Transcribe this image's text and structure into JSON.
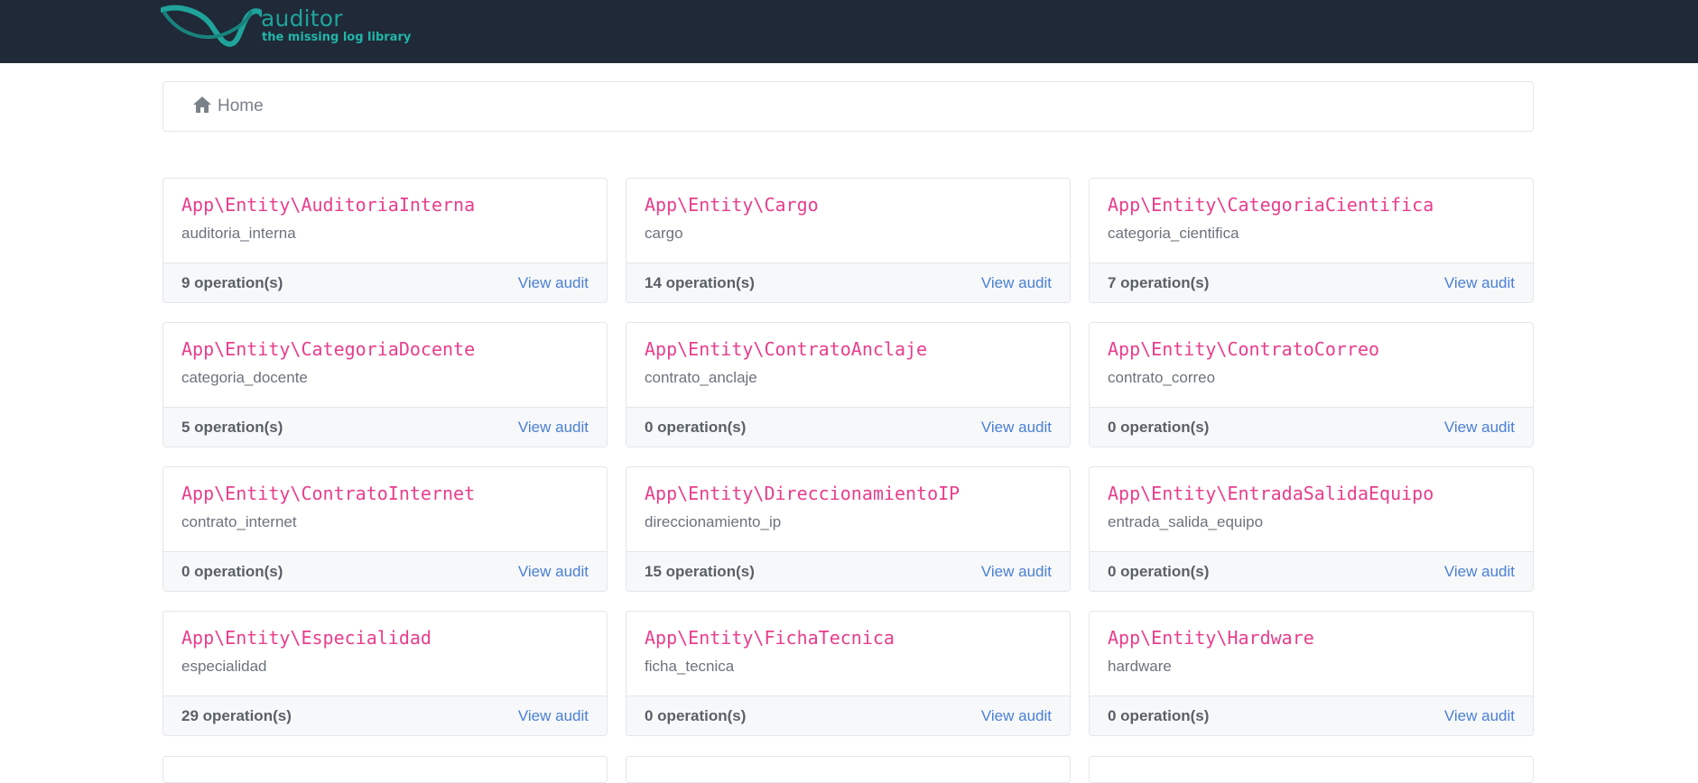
{
  "brand": {
    "name": "auditor",
    "tagline": "the missing log library",
    "name_color": "#1fa39b",
    "tagline_color": "#22b5a8"
  },
  "navbar": {
    "background": "#1f2937"
  },
  "breadcrumb": {
    "icon": "home-icon",
    "label": "Home"
  },
  "cards": [
    {
      "entity": "App\\Entity\\AuditoriaInterna",
      "table": "auditoria_interna",
      "operations": "9 operation(s)",
      "link": "View audit"
    },
    {
      "entity": "App\\Entity\\Cargo",
      "table": "cargo",
      "operations": "14 operation(s)",
      "link": "View audit"
    },
    {
      "entity": "App\\Entity\\CategoriaCientifica",
      "table": "categoria_cientifica",
      "operations": "7 operation(s)",
      "link": "View audit"
    },
    {
      "entity": "App\\Entity\\CategoriaDocente",
      "table": "categoria_docente",
      "operations": "5 operation(s)",
      "link": "View audit"
    },
    {
      "entity": "App\\Entity\\ContratoAnclaje",
      "table": "contrato_anclaje",
      "operations": "0 operation(s)",
      "link": "View audit"
    },
    {
      "entity": "App\\Entity\\ContratoCorreo",
      "table": "contrato_correo",
      "operations": "0 operation(s)",
      "link": "View audit"
    },
    {
      "entity": "App\\Entity\\ContratoInternet",
      "table": "contrato_internet",
      "operations": "0 operation(s)",
      "link": "View audit"
    },
    {
      "entity": "App\\Entity\\DireccionamientoIP",
      "table": "direccionamiento_ip",
      "operations": "15 operation(s)",
      "link": "View audit"
    },
    {
      "entity": "App\\Entity\\EntradaSalidaEquipo",
      "table": "entrada_salida_equipo",
      "operations": "0 operation(s)",
      "link": "View audit"
    },
    {
      "entity": "App\\Entity\\Especialidad",
      "table": "especialidad",
      "operations": "29 operation(s)",
      "link": "View audit"
    },
    {
      "entity": "App\\Entity\\FichaTecnica",
      "table": "ficha_tecnica",
      "operations": "0 operation(s)",
      "link": "View audit"
    },
    {
      "entity": "App\\Entity\\Hardware",
      "table": "hardware",
      "operations": "0 operation(s)",
      "link": "View audit"
    }
  ],
  "colors": {
    "entity_name": "#e83e8c",
    "link": "#4a7fd6",
    "footer_background": "#f7f8f9"
  }
}
